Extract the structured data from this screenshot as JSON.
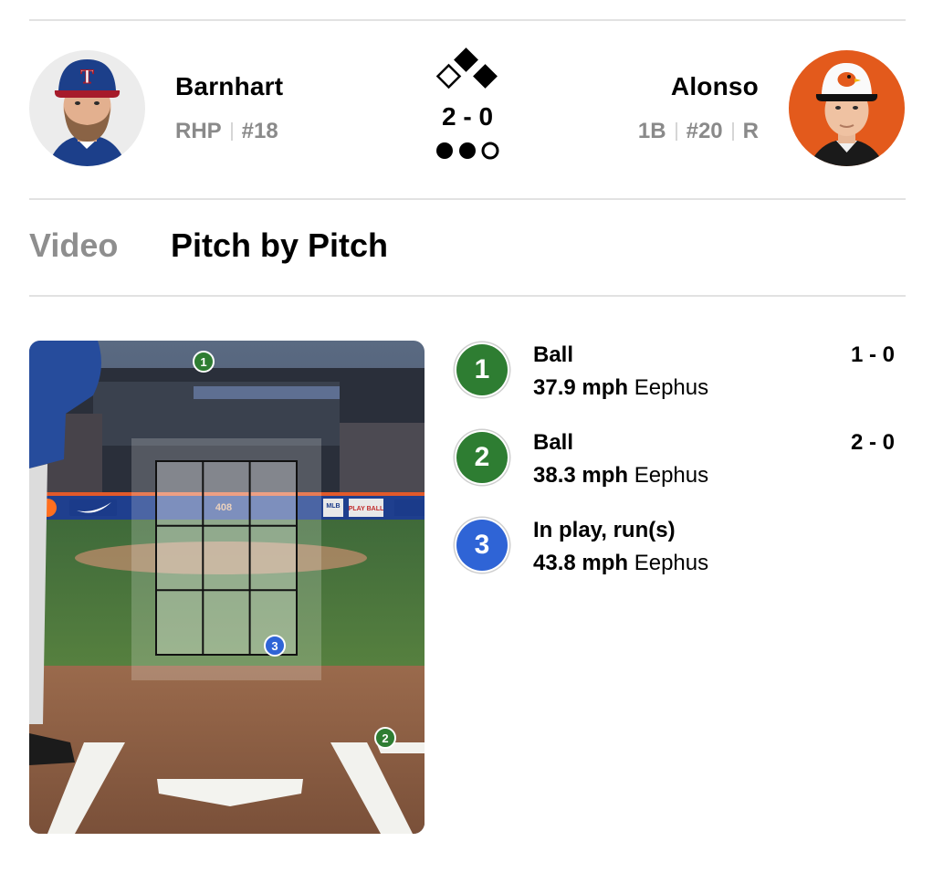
{
  "pitcher": {
    "name": "Barnhart",
    "hand": "RHP",
    "number": "#18",
    "cap_logo": "T"
  },
  "batter": {
    "name": "Alonso",
    "position": "1B",
    "number": "#20",
    "bats": "R"
  },
  "situation": {
    "count": "2 - 0",
    "bases": {
      "first": true,
      "second": true,
      "third": false
    },
    "outs": 2
  },
  "tabs": [
    {
      "label": "Video",
      "active": false
    },
    {
      "label": "Pitch by Pitch",
      "active": true
    }
  ],
  "zone": {
    "wall_distance": "408",
    "ad_label": "PLAY BALL",
    "mlb_label": "MLB"
  },
  "pitches": [
    {
      "number": "1",
      "result": "Ball",
      "count": "1 - 0",
      "speed": "37.9 mph",
      "type": "Eephus",
      "color": "#2e7d32"
    },
    {
      "number": "2",
      "result": "Ball",
      "count": "2 - 0",
      "speed": "38.3 mph",
      "type": "Eephus",
      "color": "#2e7d32"
    },
    {
      "number": "3",
      "result": "In play, run(s)",
      "count": "",
      "speed": "43.8 mph",
      "type": "Eephus",
      "color": "#2f64d6"
    }
  ],
  "colors": {
    "ball": "#2e7d32",
    "in_play": "#2f64d6",
    "batter_bg": "#e35a1c",
    "pitcher_bg": "#ececec"
  }
}
